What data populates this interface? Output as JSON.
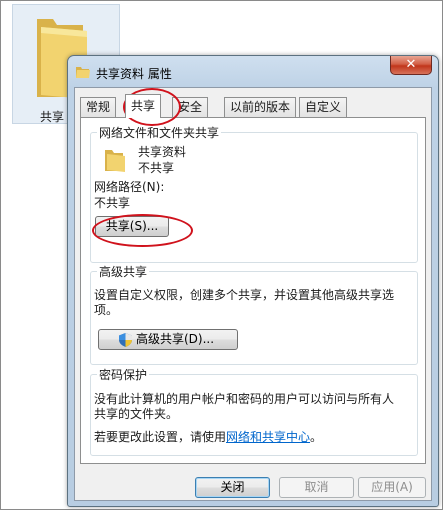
{
  "desktop": {
    "folder_label": "共享"
  },
  "window": {
    "title": "共享资料 属性",
    "close_symbol": "✕"
  },
  "tabs": [
    {
      "label": "常规"
    },
    {
      "label": "共享"
    },
    {
      "label": "安全"
    },
    {
      "label": "以前的版本"
    },
    {
      "label": "自定义"
    }
  ],
  "network_share": {
    "group_title": "网络文件和文件夹共享",
    "folder_name": "共享资料",
    "folder_status": "不共享",
    "path_label": "网络路径(N):",
    "path_value": "不共享",
    "share_button": "共享(S)..."
  },
  "advanced_share": {
    "group_title": "高级共享",
    "description_line1": "设置自定义权限，创建多个共享，并设置其他高级共享选",
    "description_line2": "项。",
    "button": "高级共享(D)..."
  },
  "password_protection": {
    "group_title": "密码保护",
    "description_line1": "没有此计算机的用户帐户和密码的用户可以访问与所有人",
    "description_line2": "共享的文件夹。",
    "change_prefix": "若要更改此设置，请使用",
    "link_text": "网络和共享中心",
    "change_suffix": "。"
  },
  "footer": {
    "close": "关闭",
    "cancel": "取消",
    "apply": "应用(A)"
  },
  "colors": {
    "highlight_ellipse": "#d0121c",
    "link": "#0066cc",
    "close_button": "#c1361b"
  }
}
